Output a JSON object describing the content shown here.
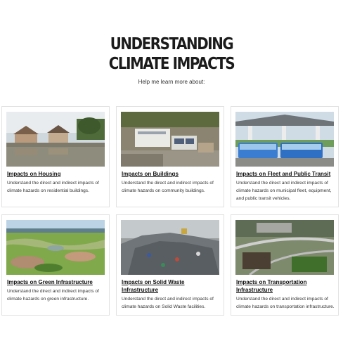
{
  "header": {
    "title_line1": "UNDERSTANDING",
    "title_line2": "CLIMATE IMPACTS",
    "subtitle": "Help me learn more about:"
  },
  "cards": [
    {
      "title": "Impacts on Housing",
      "description": "Understand the direct and indirect impacts of climate hazards on residential buildings."
    },
    {
      "title": "Impacts on Buildings",
      "description": "Understand the direct and indirect impacts of climate hazards on community buildings."
    },
    {
      "title": "Impacts on Fleet and Public Transit",
      "description": "Understand the direct and indirect impacts of climate hazards on municipal fleet, equipment, and public transit vehicles."
    },
    {
      "title": "Impacts on Green Infrastructure",
      "description": "Understand the direct and indirect impacts of climate hazards on green infrastructure."
    },
    {
      "title": "Impacts on Solid Waste Infrastructure",
      "description": "Understand the direct and indirect impacts of climate hazards on Solid Waste facilities."
    },
    {
      "title": "Impacts on Transportation Infrastructure",
      "description": "Understand the direct and indirect impacts of climate hazards on transportation infrastructure."
    }
  ]
}
